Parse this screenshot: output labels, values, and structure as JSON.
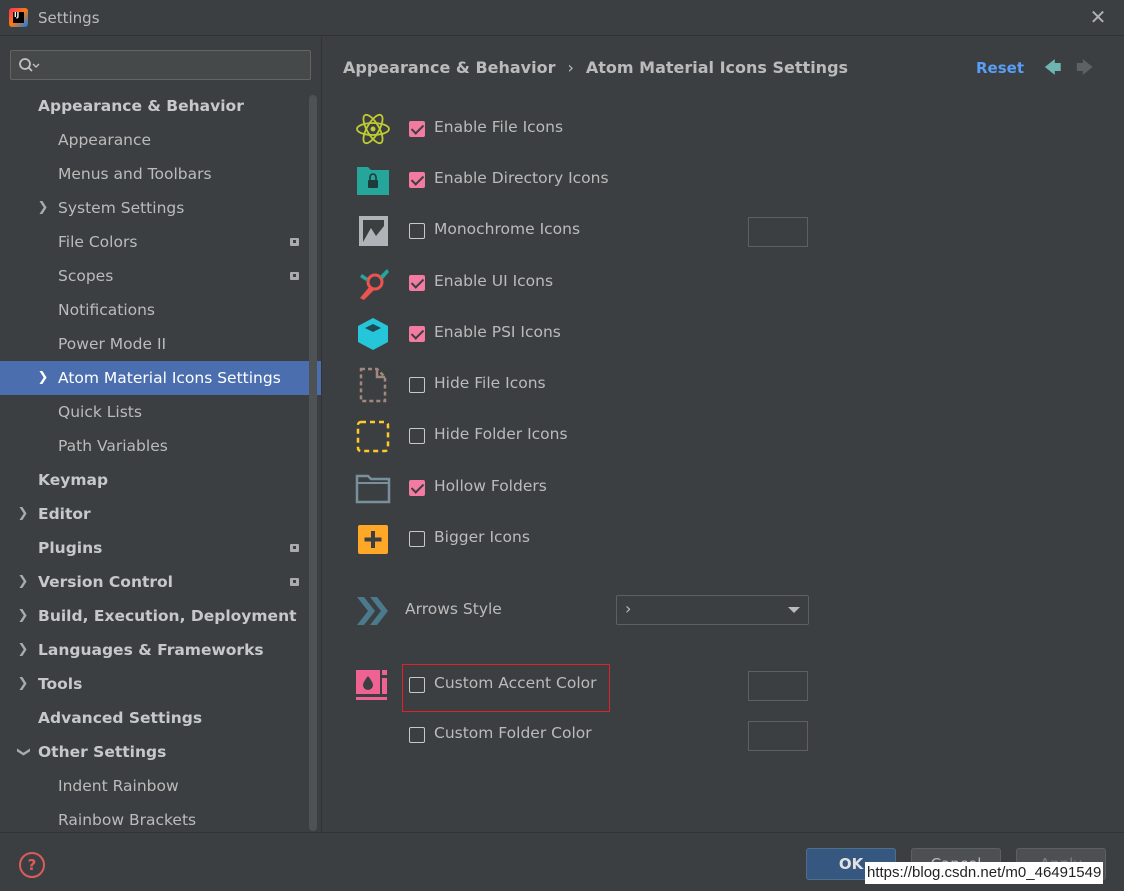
{
  "window": {
    "title": "Settings",
    "close_glyph": "✕",
    "logo_text": "IJ"
  },
  "search": {
    "value": "",
    "placeholder": ""
  },
  "sidebar": {
    "items": [
      {
        "label": "Appearance & Behavior",
        "level": 0,
        "expanded": true
      },
      {
        "label": "Appearance",
        "level": 1
      },
      {
        "label": "Menus and Toolbars",
        "level": 1
      },
      {
        "label": "System Settings",
        "level": 1,
        "collapsed": true
      },
      {
        "label": "File Colors",
        "level": 1,
        "badge": true
      },
      {
        "label": "Scopes",
        "level": 1,
        "badge": true
      },
      {
        "label": "Notifications",
        "level": 1
      },
      {
        "label": "Power Mode II",
        "level": 1
      },
      {
        "label": "Atom Material Icons Settings",
        "level": 1,
        "collapsed": true,
        "selected": true
      },
      {
        "label": "Quick Lists",
        "level": 1
      },
      {
        "label": "Path Variables",
        "level": 1
      },
      {
        "label": "Keymap",
        "level": 0
      },
      {
        "label": "Editor",
        "level": 0,
        "collapsed": true
      },
      {
        "label": "Plugins",
        "level": 0,
        "badge": true
      },
      {
        "label": "Version Control",
        "level": 0,
        "collapsed": true,
        "badge": true
      },
      {
        "label": "Build, Execution, Deployment",
        "level": 0,
        "collapsed": true
      },
      {
        "label": "Languages & Frameworks",
        "level": 0,
        "collapsed": true
      },
      {
        "label": "Tools",
        "level": 0,
        "collapsed": true
      },
      {
        "label": "Advanced Settings",
        "level": 0
      },
      {
        "label": "Other Settings",
        "level": 0,
        "expanded": true
      },
      {
        "label": "Indent Rainbow",
        "level": 1
      },
      {
        "label": "Rainbow Brackets",
        "level": 1
      }
    ]
  },
  "header": {
    "breadcrumb_parent": "Appearance & Behavior",
    "breadcrumb_sep": "›",
    "breadcrumb_current": "Atom Material Icons Settings",
    "reset_label": "Reset",
    "back_glyph": "🡄",
    "forward_glyph": "🡆"
  },
  "options": [
    {
      "label": "Enable File Icons",
      "checked": true,
      "icon": "atom-icon"
    },
    {
      "label": "Enable Directory Icons",
      "checked": true,
      "icon": "folder-lock-icon"
    },
    {
      "label": "Monochrome Icons",
      "checked": false,
      "icon": "monochrome-image-icon",
      "swatch": true
    },
    {
      "label": "Enable UI Icons",
      "checked": true,
      "icon": "ui-tools-icon"
    },
    {
      "label": "Enable PSI Icons",
      "checked": true,
      "icon": "psi-cube-icon"
    },
    {
      "label": "Hide File Icons",
      "checked": false,
      "icon": "dashed-file-icon"
    },
    {
      "label": "Hide Folder Icons",
      "checked": false,
      "icon": "dashed-folder-icon"
    },
    {
      "label": "Hollow Folders",
      "checked": true,
      "icon": "hollow-folder-icon"
    },
    {
      "label": "Bigger Icons",
      "checked": false,
      "icon": "plus-square-icon"
    }
  ],
  "arrows_style": {
    "label": "Arrows Style",
    "value": "›",
    "icon": "double-chevron-icon"
  },
  "accent": {
    "label": "Custom Accent Color",
    "checked": false,
    "icon": "accent-palette-icon"
  },
  "folder_color": {
    "label": "Custom Folder Color",
    "checked": false
  },
  "footer": {
    "help_label": "?",
    "ok_label": "OK",
    "cancel_label": "Cancel",
    "apply_label": "Apply",
    "watermark": "https://blog.csdn.net/m0_46491549"
  },
  "colors": {
    "checkbox_checked": "#f37aa0",
    "selection": "#4b6eaf",
    "link": "#589df6",
    "highlight_box": "#e0202a",
    "ok_button": "#365880"
  }
}
